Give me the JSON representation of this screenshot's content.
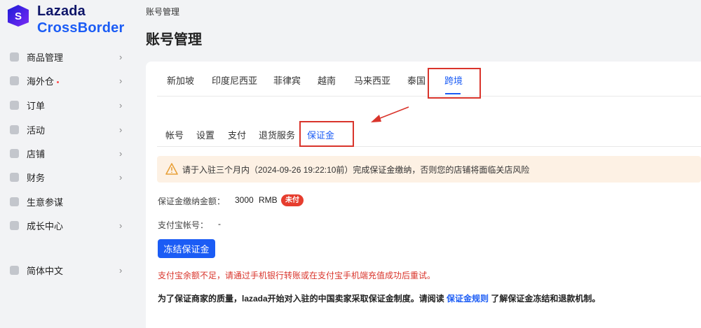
{
  "brand": {
    "line1": "Lazada",
    "line2": "CrossBorder",
    "colors": {
      "navy": "#0f1669",
      "blue": "#1b5cf5"
    }
  },
  "sidebar": {
    "items": [
      {
        "label": "商品管理",
        "icon": "box-icon",
        "has_dot": false
      },
      {
        "label": "海外仓",
        "icon": "warehouse-icon",
        "has_dot": true
      },
      {
        "label": "订单",
        "icon": "order-icon",
        "has_dot": false
      },
      {
        "label": "活动",
        "icon": "activity-icon",
        "has_dot": false
      },
      {
        "label": "店铺",
        "icon": "store-icon",
        "has_dot": false
      },
      {
        "label": "财务",
        "icon": "finance-icon",
        "has_dot": false
      },
      {
        "label": "生意参谋",
        "icon": "insight-icon",
        "has_dot": false
      },
      {
        "label": "成长中心",
        "icon": "growth-icon",
        "has_dot": false
      },
      {
        "label": "简体中文",
        "icon": "language-icon",
        "has_dot": false
      }
    ]
  },
  "header": {
    "breadcrumb": "账号管理",
    "title": "账号管理"
  },
  "country_tabs": [
    "新加坡",
    "印度尼西亚",
    "菲律宾",
    "越南",
    "马来西亚",
    "泰国",
    "跨境"
  ],
  "country_active": "跨境",
  "sub_tabs": [
    "帐号",
    "设置",
    "支付",
    "退货服务",
    "保证金"
  ],
  "sub_active": "保证金",
  "warning": "请于入驻三个月内（2024-09-26 19:22:10前）完成保证金缴纳，否则您的店铺将面临关店风险",
  "deposit": {
    "amount_label": "保证金缴纳金额：",
    "amount": "3000",
    "currency": "RMB",
    "status": "未付",
    "alipay_label": "支付宝帐号：",
    "alipay_value": "-"
  },
  "freeze_button": "冻结保证金",
  "error": "支付宝余额不足，请通过手机银行转账或在支付宝手机端充值成功后重试。",
  "notice": {
    "before": "为了保证商家的质量，lazada开始对入驻的中国卖家采取保证金制度。请阅读",
    "link": "保证金规则",
    "after": "了解保证金冻结和退款机制。"
  },
  "colors": {
    "accent": "#1b5cf5",
    "danger": "#e63d2e",
    "warning_bg": "#fdf1e4",
    "annotation": "#d9342b"
  }
}
